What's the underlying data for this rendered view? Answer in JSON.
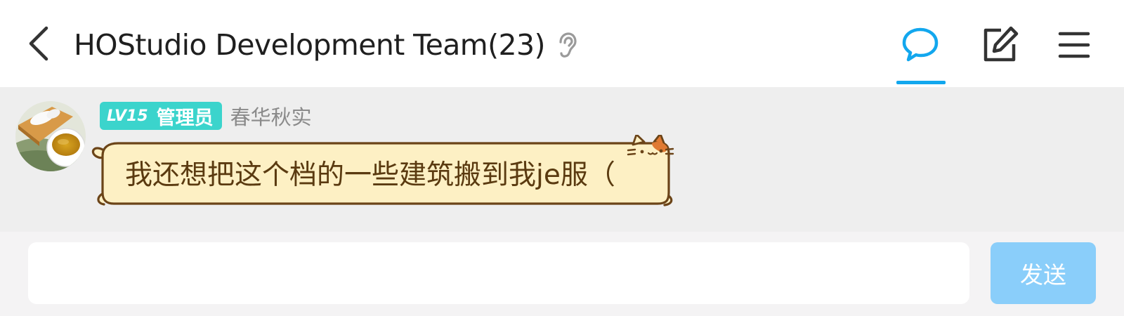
{
  "header": {
    "title": "HOStudio Development Team(23)",
    "icons": {
      "back": "chevron-left-icon",
      "ear": "ear-icon",
      "chat": "chat-bubble-icon",
      "edit": "edit-icon",
      "menu": "hamburger-menu-icon"
    },
    "active_tab_color": "#12a7ee"
  },
  "messages": [
    {
      "avatar": "tea-cup-avatar",
      "level_badge": "LV15",
      "role_badge": "管理员",
      "sender": "春华秋实",
      "text": "我还想把这个档的一些建筑搬到我je服（",
      "bubble_style": "cat-bubble"
    }
  ],
  "input": {
    "value": "",
    "placeholder": ""
  },
  "send_button": {
    "label": "发送",
    "color": "#8acefa"
  }
}
